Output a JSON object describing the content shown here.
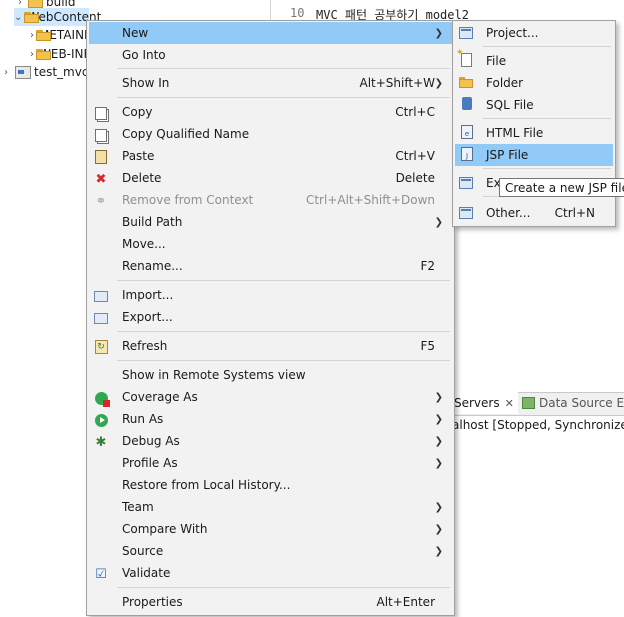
{
  "explorer": {
    "rows": [
      {
        "label": "build"
      },
      {
        "label": "WebContent"
      },
      {
        "label": "METAINF"
      },
      {
        "label": "WEB-INF"
      },
      {
        "label": "test_mvc"
      }
    ]
  },
  "editor": {
    "line_no": "10",
    "line_text": "MVC 패턴 공부하기 model2"
  },
  "servers_panel": {
    "servers_tab": "Servers",
    "datasource_tab": "Data Source Ex",
    "row_text": "alhost  [Stopped, Synchronized"
  },
  "context_menu": {
    "items": [
      {
        "label": "New",
        "shortcut": "",
        "submenu": true,
        "icon": "none",
        "highlighted": true
      },
      {
        "label": "Go Into",
        "shortcut": "",
        "icon": "none"
      },
      {
        "label": "Show In",
        "shortcut": "Alt+Shift+W",
        "submenu": true,
        "icon": "none"
      },
      {
        "label": "Copy",
        "shortcut": "Ctrl+C",
        "icon": "copy-icon"
      },
      {
        "label": "Copy Qualified Name",
        "shortcut": "",
        "icon": "copy-qualified-name-icon"
      },
      {
        "label": "Paste",
        "shortcut": "Ctrl+V",
        "icon": "paste-icon"
      },
      {
        "label": "Delete",
        "shortcut": "Delete",
        "icon": "delete-icon"
      },
      {
        "label": "Remove from Context",
        "shortcut": "Ctrl+Alt+Shift+Down",
        "icon": "remove-context-icon",
        "disabled": true
      },
      {
        "label": "Build Path",
        "shortcut": "",
        "submenu": true,
        "icon": "none"
      },
      {
        "label": "Move...",
        "shortcut": "",
        "icon": "none"
      },
      {
        "label": "Rename...",
        "shortcut": "F2",
        "icon": "none"
      },
      {
        "label": "Import...",
        "shortcut": "",
        "icon": "import-icon"
      },
      {
        "label": "Export...",
        "shortcut": "",
        "icon": "export-icon"
      },
      {
        "label": "Refresh",
        "shortcut": "F5",
        "icon": "refresh-icon"
      },
      {
        "label": "Show in Remote Systems view",
        "shortcut": "",
        "icon": "none"
      },
      {
        "label": "Coverage As",
        "shortcut": "",
        "submenu": true,
        "icon": "coverage-icon"
      },
      {
        "label": "Run As",
        "shortcut": "",
        "submenu": true,
        "icon": "run-icon"
      },
      {
        "label": "Debug As",
        "shortcut": "",
        "submenu": true,
        "icon": "debug-bug-icon"
      },
      {
        "label": "Profile As",
        "shortcut": "",
        "submenu": true,
        "icon": "none"
      },
      {
        "label": "Restore from Local History...",
        "shortcut": "",
        "icon": "none"
      },
      {
        "label": "Team",
        "shortcut": "",
        "submenu": true,
        "icon": "none"
      },
      {
        "label": "Compare With",
        "shortcut": "",
        "submenu": true,
        "icon": "none"
      },
      {
        "label": "Source",
        "shortcut": "",
        "submenu": true,
        "icon": "none"
      },
      {
        "label": "Validate",
        "shortcut": "",
        "icon": "validate-check-icon"
      },
      {
        "label": "Properties",
        "shortcut": "Alt+Enter",
        "icon": "none"
      }
    ]
  },
  "new_submenu": {
    "items": [
      {
        "label": "Project...",
        "shortcut": "",
        "icon": "new-project-icon"
      },
      {
        "label": "File",
        "shortcut": "",
        "icon": "new-file-icon"
      },
      {
        "label": "Folder",
        "shortcut": "",
        "icon": "new-folder-icon"
      },
      {
        "label": "SQL File",
        "shortcut": "",
        "icon": "sql-file-icon"
      },
      {
        "label": "HTML File",
        "shortcut": "",
        "icon": "html-file-icon"
      },
      {
        "label": "JSP File",
        "shortcut": "",
        "icon": "jsp-file-icon",
        "highlighted": true
      },
      {
        "label": "Ex",
        "shortcut": "",
        "icon": "example-icon"
      },
      {
        "label": "Other...",
        "shortcut": "Ctrl+N",
        "icon": "other-wizard-icon"
      }
    ]
  },
  "tooltip": {
    "text": "Create a new JSP file"
  },
  "colors": {
    "highlight": "#91c9f7",
    "menu_bg": "#f2f2f2",
    "explorer_selection": "#cde8ff"
  }
}
